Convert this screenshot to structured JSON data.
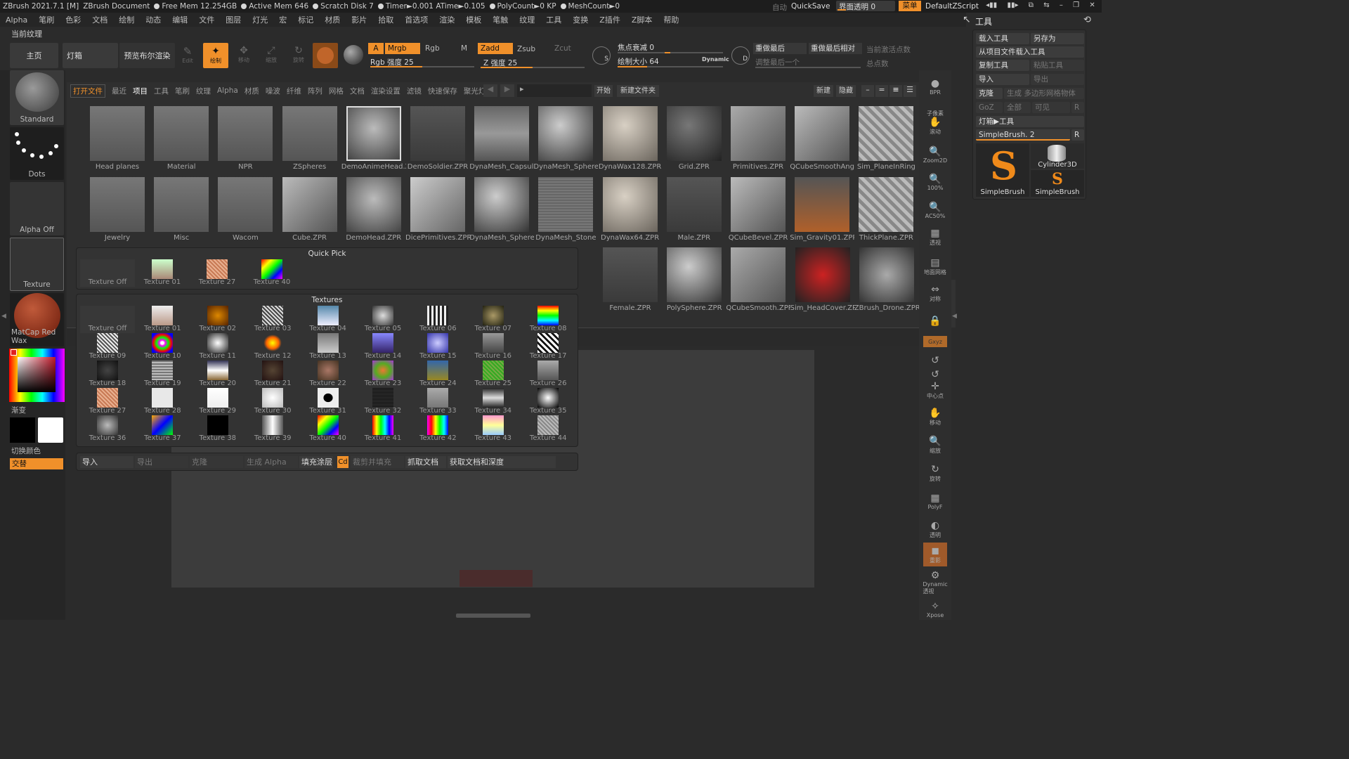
{
  "titlebar": {
    "app": "ZBrush 2021.7.1 [M]",
    "doc": "ZBrush Document",
    "free_mem": "Free Mem 12.254GB",
    "active_mem": "Active Mem 646",
    "scratch": "Scratch Disk 7",
    "timer": "Timer►0.001 ATime►0.105",
    "poly": "PolyCount►0 KP",
    "mesh": "MeshCount►0",
    "auto": "自动",
    "quicksave": "QuickSave",
    "transparency": "界面透明 0",
    "menu": "菜单",
    "script": "DefaultZScript"
  },
  "menus": [
    "Alpha",
    "笔刷",
    "色彩",
    "文档",
    "绘制",
    "动态",
    "编辑",
    "文件",
    "图层",
    "灯光",
    "宏",
    "标记",
    "材质",
    "影片",
    "拾取",
    "首选项",
    "渲染",
    "模板",
    "笔触",
    "纹理",
    "工具",
    "变换",
    "Z插件",
    "Z脚本",
    "帮助"
  ],
  "subtitle": "当前纹理",
  "top": {
    "home": "主页",
    "lightbox": "灯箱",
    "preview": "预览布尔渲染",
    "edit": "Edit",
    "draw": "绘制",
    "move": "移动",
    "scale": "缩放",
    "rotate": "旋转",
    "a": "A",
    "mrgb": "Mrgb",
    "rgb": "Rgb",
    "m": "M",
    "rgb_strength": "Rgb 强度 25",
    "zadd": "Zadd",
    "zsub": "Zsub",
    "zcut": "Zcut",
    "z_strength": "Z 强度 25",
    "focal": "焦点衰减 0",
    "draw_size": "绘制大小 64",
    "dynamic": "Dynamic",
    "redo_last": "重做最后",
    "redo_rel": "重做最后相对",
    "adjust_last": "调整最后一个",
    "active_points": "当前激活点数",
    "total_points": "总点数",
    "s": "S",
    "d": "D"
  },
  "left": {
    "standard": "Standard",
    "dots": "Dots",
    "alpha_off": "Alpha Off",
    "texture": "Texture",
    "matcap": "MatCap Red Wax",
    "gradient": "渐变",
    "switch_color": "切换颜色",
    "alternate": "交替"
  },
  "lightbox": {
    "tabs": [
      "打开文件",
      "最近",
      "项目",
      "工具",
      "笔刷",
      "纹理",
      "Alpha",
      "材质",
      "噪波",
      "纤维",
      "阵列",
      "网格",
      "文档",
      "渲染设置",
      "滤镜",
      "快速保存",
      "聚光灯"
    ],
    "start": "开始",
    "new_folder": "新建文件夹",
    "new": "新建",
    "hide": "隐藏",
    "row1": [
      "Head planes",
      "Material",
      "NPR",
      "ZSpheres",
      "DemoAnimeHead.ZPR",
      "DemoSoldier.ZPR",
      "DynaMesh_Capsule",
      "DynaMesh_Sphere",
      "DynaWax128.ZPR",
      "Grid.ZPR",
      "Primitives.ZPR",
      "QCubeSmoothAngle",
      "Sim_PlaneInRing"
    ],
    "row2": [
      "Jewelry",
      "Misc",
      "Wacom",
      "Cube.ZPR",
      "DemoHead.ZPR",
      "DicePrimitives.ZPR",
      "DynaMesh_Sphere",
      "DynaMesh_Stone",
      "DynaWax64.ZPR",
      "Male.ZPR",
      "QCubeBevel.ZPR",
      "Sim_Gravity01.ZPR",
      "ThickPlane.ZPR"
    ],
    "row3": [
      "Female.ZPR",
      "PolySphere.ZPR",
      "QCubeSmooth.ZPR",
      "Sim_HeadCover.ZPR",
      "ZBrush_Drone.ZPR"
    ]
  },
  "quickpick": {
    "title": "Quick Pick",
    "items": [
      "Texture Off",
      "Texture 01",
      "Texture 27",
      "Texture 40"
    ]
  },
  "textures": {
    "title": "Textures",
    "items": [
      "Texture Off",
      "Texture 01",
      "Texture 02",
      "Texture 03",
      "Texture 04",
      "Texture 05",
      "Texture 06",
      "Texture 07",
      "Texture 08",
      "Texture 09",
      "Texture 10",
      "Texture 11",
      "Texture 12",
      "Texture 13",
      "Texture 14",
      "Texture 15",
      "Texture 16",
      "Texture 17",
      "Texture 18",
      "Texture 19",
      "Texture 20",
      "Texture 21",
      "Texture 22",
      "Texture 23",
      "Texture 24",
      "Texture 25",
      "Texture 26",
      "Texture 27",
      "Texture 28",
      "Texture 29",
      "Texture 30",
      "Texture 31",
      "Texture 32",
      "Texture 33",
      "Texture 34",
      "Texture 35",
      "Texture 36",
      "Texture 37",
      "Texture 38",
      "Texture 39",
      "Texture 40",
      "Texture 41",
      "Texture 42",
      "Texture 43",
      "Texture 44"
    ]
  },
  "bottombar": {
    "import": "导入",
    "export": "导出",
    "clone": "克隆",
    "make_alpha": "生成 Alpha",
    "fill_layer": "填充涂层",
    "cd": "Cd",
    "crop_fill": "裁剪并填充",
    "grab_doc": "抓取文档",
    "grab_doc_depth": "获取文档和深度"
  },
  "righttools": [
    "BPR",
    "子像素",
    "滚动",
    "Zoom2D",
    "100%",
    "AC50%",
    "透视",
    "地面网格",
    "对称",
    "",
    "Gxyz",
    "",
    "",
    "中心点",
    "移动",
    "缩放",
    "旋转",
    "PolyF",
    "透明",
    "重影",
    "Dynamic 透视",
    "Xpose"
  ],
  "toolpanel": {
    "title": "工具",
    "load": "载入工具",
    "save_as": "另存为",
    "load_from_project": "从项目文件载入工具",
    "copy": "复制工具",
    "paste": "粘贴工具",
    "import": "导入",
    "export": "导出",
    "clone": "克隆",
    "make_polymesh": "生成 多边形网格物体",
    "goz": "GoZ",
    "all": "全部",
    "visible": "可见",
    "r": "R",
    "lightbox_tools": "灯箱▶工具",
    "current_tool": "SimpleBrush. 2",
    "tool1": "SimpleBrush",
    "tool2": "Cylinder3D",
    "tool3": "SimpleBrush"
  }
}
